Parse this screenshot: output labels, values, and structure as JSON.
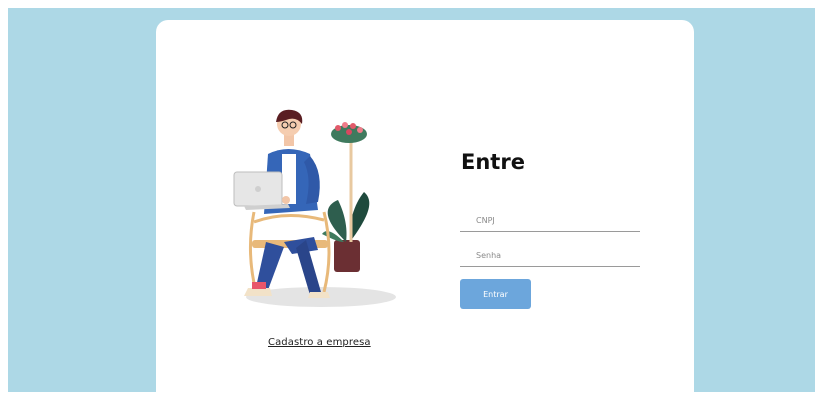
{
  "colors": {
    "background": "#add8e6",
    "card": "#ffffff",
    "button": "#6ca6dc",
    "title": "#111111"
  },
  "login": {
    "title": "Entre",
    "cnpj_placeholder": "CNPJ",
    "password_placeholder": "Senha",
    "submit_label": "Entrar",
    "signup_link": "Cadastro a empresa"
  },
  "illustration": {
    "icon": "person-with-laptop-illustration"
  }
}
